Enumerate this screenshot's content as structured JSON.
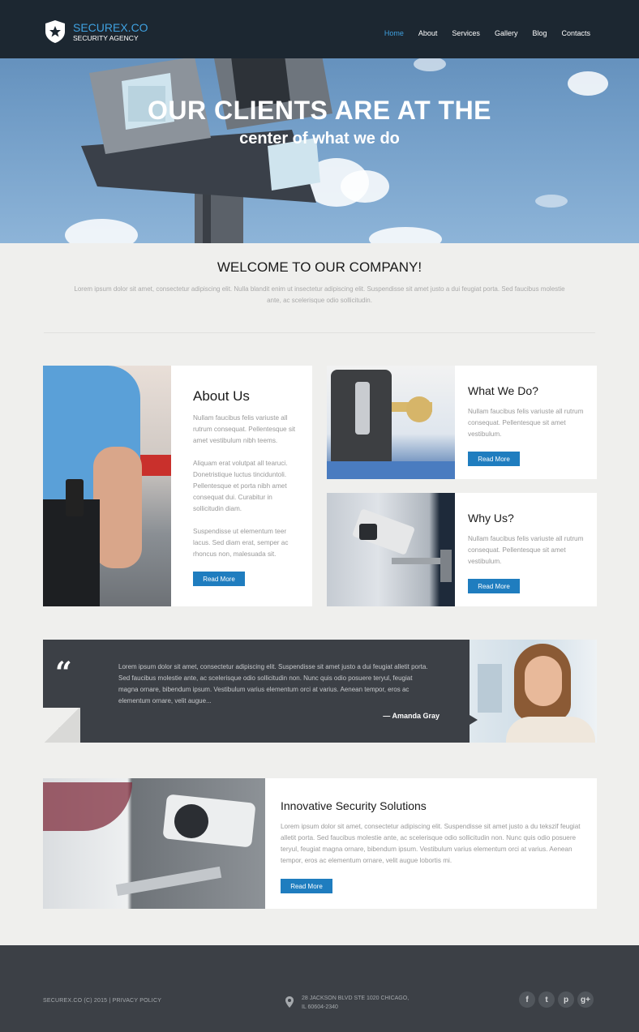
{
  "brand": {
    "name": "SECUREX.CO",
    "tagline": "SECURITY AGENCY"
  },
  "nav": {
    "items": [
      {
        "label": "Home",
        "active": true
      },
      {
        "label": "About",
        "active": false
      },
      {
        "label": "Services",
        "active": false
      },
      {
        "label": "Gallery",
        "active": false
      },
      {
        "label": "Blog",
        "active": false
      },
      {
        "label": "Contacts",
        "active": false
      }
    ]
  },
  "hero": {
    "title": "OUR CLIENTS ARE AT THE",
    "subtitle": "center of what we do"
  },
  "welcome": {
    "title": "WELCOME TO OUR COMPANY!",
    "text": "Lorem ipsum dolor sit amet, consectetur adipiscing elit. Nulla blandit enim ut insectetur adipiscing elit. Suspendisse sit amet justo a dui feugiat porta. Sed faucibus molestie ante, ac scelerisque odio sollicitudin."
  },
  "about": {
    "title": "About Us",
    "p1": "Nullam faucibus felis variuste all rutrum consequat. Pellentesque sit amet vestibulum nibh teems.",
    "p2": "Aliquam erat volutpat all tearuci. Donetristique luctus tinciduntoli. Pellentesque et porta nibh amet consequat dui. Curabitur in sollicitudin diam.",
    "p3": "Suspendisse ut elementum teer lacus. Sed diam erat, semper ac rhoncus non, malesuada sit.",
    "button": "Read More"
  },
  "what": {
    "title": "What We Do?",
    "text": "Nullam faucibus felis variuste all rutrum consequat. Pellentesque sit amet vestibulum.",
    "button": "Read More"
  },
  "why": {
    "title": "Why Us?",
    "text": "Nullam faucibus felis variuste all rutrum consequat. Pellentesque sit amet vestibulum.",
    "button": "Read More"
  },
  "testimonial": {
    "quote_mark": "“",
    "text": "Lorem ipsum dolor sit amet, consectetur adipiscing elit. Suspendisse sit amet justo a dui feugiat alletit porta. Sed faucibus molestie ante, ac scelerisque odio sollicitudin non. Nunc quis odio posuere teryul, feugiat magna ornare, bibendum ipsum. Vestibulum varius elementum orci at varius. Aenean tempor, eros ac elementum ornare, velit augue...",
    "author": "— Amanda Gray"
  },
  "solutions": {
    "title": "Innovative Security Solutions",
    "text": "Lorem ipsum dolor sit amet, consectetur adipiscing elit. Suspendisse sit amet justo a du tekszif feugiat alletit porta. Sed faucibus molestie ante, ac scelerisque odio sollicitudin non. Nunc quis odio posuere teryul, feugiat magna ornare, bibendum ipsum. Vestibulum varius elementum orci at varius. Aenean tempor, eros ac elementum ornare, velit augue lobortis mi.",
    "button": "Read More"
  },
  "footer": {
    "copyright": "SECUREX.CO (C) 2015 | PRIVACY POLICY",
    "address_line1": "28 JACKSON BLVD STE 1020 CHICAGO,",
    "address_line2": "IL 60604-2340",
    "social": [
      {
        "icon": "facebook-icon",
        "glyph": "f"
      },
      {
        "icon": "twitter-icon",
        "glyph": "t"
      },
      {
        "icon": "pinterest-icon",
        "glyph": "p"
      },
      {
        "icon": "google-plus-icon",
        "glyph": "g+"
      }
    ]
  },
  "colors": {
    "accent": "#1f7dbf",
    "link_active": "#3fa1e0",
    "dark": "#3c4046",
    "header": "#1c2731"
  }
}
